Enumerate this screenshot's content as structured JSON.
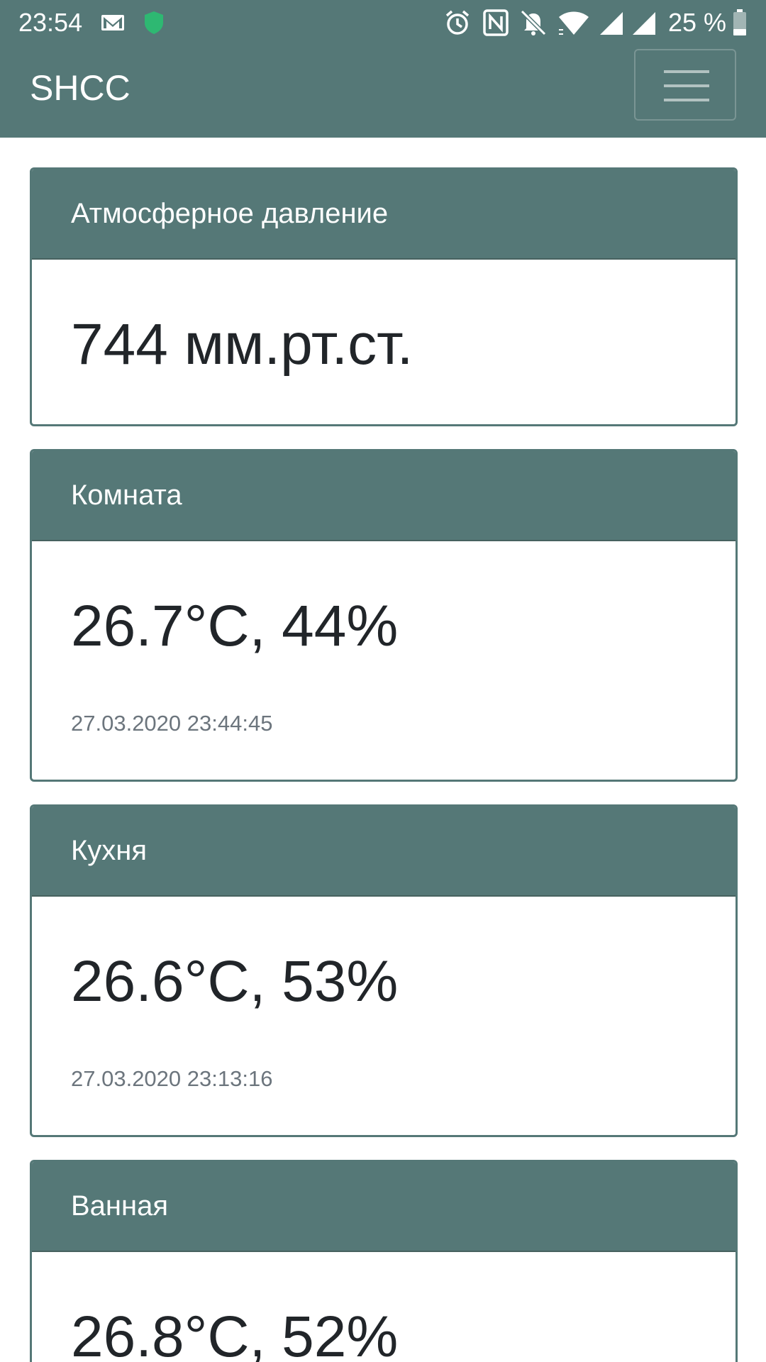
{
  "status_bar": {
    "time": "23:54",
    "battery": "25 %",
    "icons": [
      "gmail-icon",
      "shield-icon",
      "alarm-icon",
      "nfc-icon",
      "bell-off-icon",
      "wifi-icon",
      "signal-icon",
      "signal-icon",
      "battery-icon"
    ]
  },
  "navbar": {
    "brand": "SHCC",
    "menu_icon": "hamburger-icon"
  },
  "colors": {
    "primary": "#557877",
    "text": "#212529",
    "muted": "#6c757d"
  },
  "cards": [
    {
      "title": "Атмосферное давление",
      "value": "744 мм.рт.ст.",
      "timestamp": ""
    },
    {
      "title": "Комната",
      "value": "26.7°C, 44%",
      "timestamp": "27.03.2020 23:44:45"
    },
    {
      "title": "Кухня",
      "value": "26.6°C, 53%",
      "timestamp": "27.03.2020 23:13:16"
    },
    {
      "title": "Ванная",
      "value": "26.8°C, 52%",
      "timestamp": ""
    }
  ]
}
